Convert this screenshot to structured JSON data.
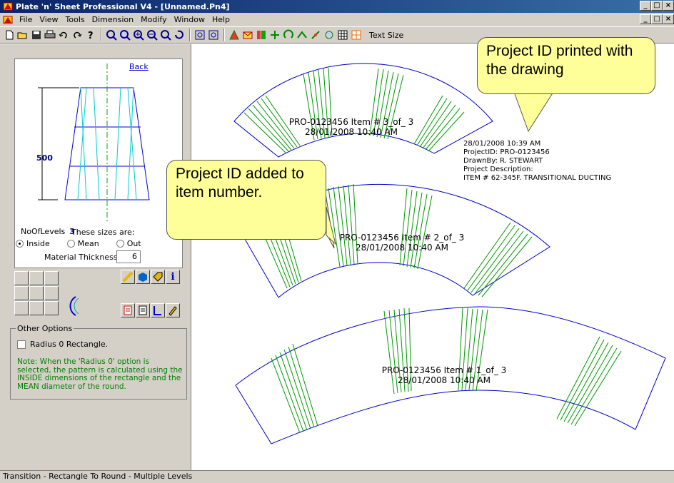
{
  "window": {
    "title": "Plate 'n' Sheet Professional V4 - [Unnamed.Pn4]",
    "minimize": "_",
    "maximize": "□",
    "close": "×"
  },
  "menu": {
    "items": [
      "File",
      "View",
      "Tools",
      "Dimension",
      "Modify",
      "Window",
      "Help"
    ]
  },
  "toolbar": {
    "text_size_label": "Text Size"
  },
  "left_panel": {
    "back_link": "Back",
    "height_dim": "500",
    "no_of_levels_label": "NoOfLevels",
    "no_of_levels_value": "3",
    "sizes_label": "These sizes are:",
    "radio_inside": "Inside",
    "radio_mean": "Mean",
    "radio_outside": "Out",
    "selected_radio": "Inside",
    "material_thickness_label": "Material Thickness",
    "material_thickness_value": "6",
    "other_options_title": "Other Options",
    "radius0_label": "Radius 0 Rectangle.",
    "note": "Note:  When the 'Radius 0' option is selected, the pattern is calculated using the INSIDE dimensions of the rectangle and the MEAN diameter of the round."
  },
  "drawing": {
    "item3": {
      "line1": "PRO-0123456 Item # 3_of_ 3",
      "line2": "28/01/2008 10:40 AM"
    },
    "item2": {
      "line1": "PRO-0123456 Item # 2_of_ 3",
      "line2": "28/01/2008 10:40 AM"
    },
    "item1": {
      "line1": "PRO-0123456 Item # 1_of_ 3",
      "line2": "28/01/2008 10:40 AM"
    },
    "info": {
      "date": "28/01/2008 10:39 AM",
      "project_id": "ProjectID: PRO-0123456",
      "drawn_by": "DrawnBy: R. STEWART",
      "desc_label": "Project Description:",
      "desc": "ITEM # 62-345F. TRANSITIONAL DUCTING"
    },
    "outline_color": "#0000cc",
    "fold_color": "#009900"
  },
  "callouts": {
    "top": "Project ID printed with the drawing",
    "middle": "Project ID added to item number."
  },
  "status_bar": "Transition - Rectangle To Round - Multiple Levels"
}
